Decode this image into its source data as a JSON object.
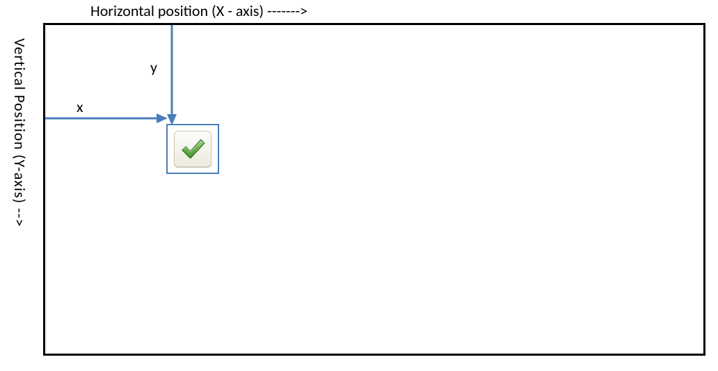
{
  "labels": {
    "x_axis": "Horizontal position (X - axis) ------->",
    "y_axis": "Vertical Position (Y-axis)  -->",
    "x_marker": "x",
    "y_marker": "y"
  },
  "icons": {
    "check": "check-icon"
  },
  "colors": {
    "arrow": "#4a7ebb",
    "border": "#000000",
    "check": "#5aa33a"
  }
}
